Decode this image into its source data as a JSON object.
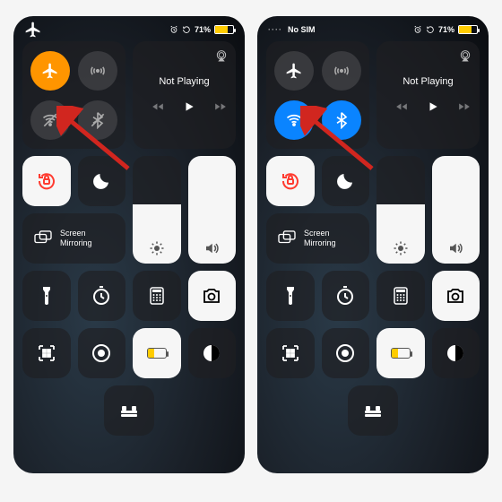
{
  "panels": [
    {
      "status": {
        "left_label": "",
        "left_mode": "airplane",
        "battery_pct": "71%",
        "battery_level": 71,
        "alarm": true,
        "lock": true
      },
      "connectivity": {
        "airplane_on": true,
        "cellular_on": false,
        "wifi_on": false,
        "bluetooth_on": false
      },
      "nowplaying": {
        "title": "Not Playing"
      },
      "mirror_label": "Screen Mirroring",
      "brightness_pct": 55,
      "volume_pct": 100,
      "arrow_to": "airplane"
    },
    {
      "status": {
        "left_label": "No SIM",
        "left_mode": "nosim",
        "battery_pct": "71%",
        "battery_level": 71,
        "alarm": true,
        "lock": true
      },
      "connectivity": {
        "airplane_on": false,
        "cellular_on": false,
        "wifi_on": true,
        "bluetooth_on": true
      },
      "nowplaying": {
        "title": "Not Playing"
      },
      "mirror_label": "Screen Mirroring",
      "brightness_pct": 55,
      "volume_pct": 100,
      "arrow_to": "airplane"
    }
  ],
  "colors": {
    "accent_orange": "#ff9500",
    "accent_blue": "#0a84ff",
    "battery_yellow": "#ffcc00",
    "arrow_red": "#d1261f"
  }
}
